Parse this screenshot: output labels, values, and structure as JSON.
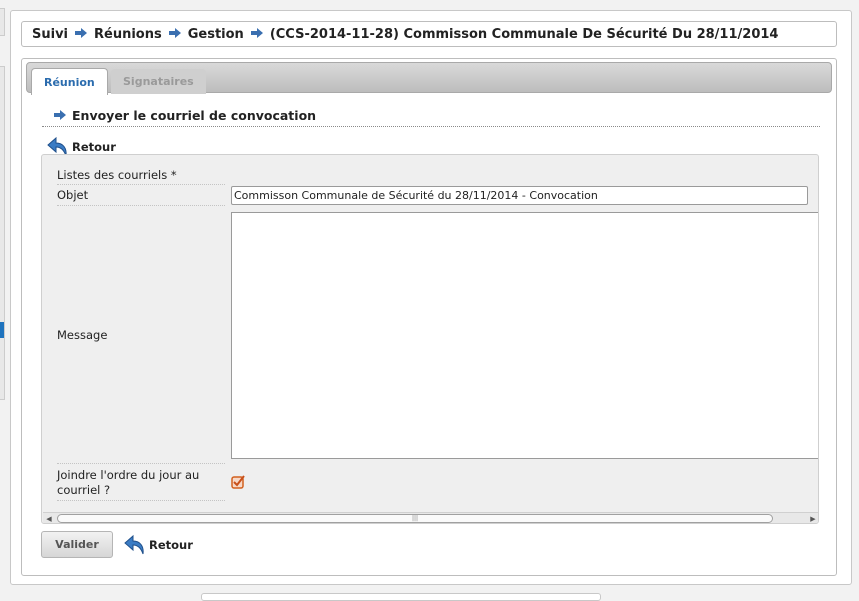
{
  "breadcrumb": {
    "items": [
      "Suivi",
      "Réunions",
      "Gestion"
    ],
    "current": "(CCS-2014-11-28) Commisson Communale De Sécurité Du 28/11/2014"
  },
  "tabs": [
    {
      "label": "Réunion",
      "active": true
    },
    {
      "label": "Signataires",
      "active": false
    }
  ],
  "section": {
    "title": "Envoyer le courriel de convocation"
  },
  "links": {
    "retour": "Retour"
  },
  "form": {
    "listes_label": "Listes des courriels *",
    "objet_label": "Objet",
    "objet_value": "Commisson Communale de Sécurité du 28/11/2014 - Convocation",
    "message_label": "Message",
    "message_value": "",
    "joindre_label": "Joindre l'ordre du jour au courriel ?",
    "joindre_checked": true
  },
  "buttons": {
    "valider": "Valider"
  },
  "colors": {
    "accent": "#2b6cae",
    "arrow": "#3a6fb0",
    "checkbox": "#e0703a"
  },
  "icons": {
    "breadcrumb_separator": "arrow-right-icon",
    "back": "back-arrow-icon",
    "checkbox": "checkbox-checked-icon"
  }
}
